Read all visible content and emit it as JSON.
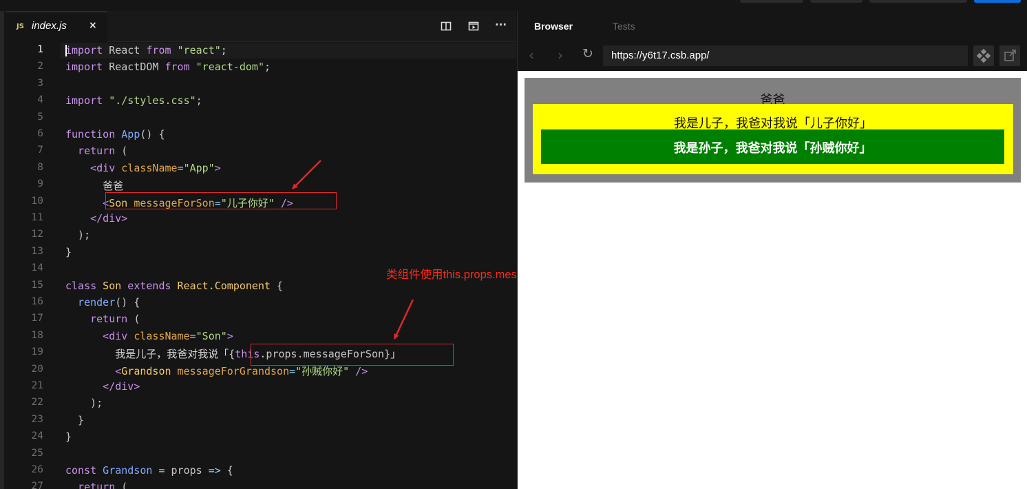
{
  "editor": {
    "tab": {
      "lang_badge": "JS",
      "filename": "index.js",
      "close_glyph": "×"
    },
    "actions": [
      "split-editor-icon",
      "preview-icon",
      "more-icon"
    ],
    "more_glyph": "···",
    "current_line": 1,
    "line_numbers": [
      "1",
      "2",
      "3",
      "4",
      "5",
      "6",
      "7",
      "8",
      "9",
      "10",
      "11",
      "12",
      "13",
      "14",
      "15",
      "16",
      "17",
      "18",
      "19",
      "20",
      "21",
      "22",
      "23",
      "24",
      "25",
      "26",
      "27"
    ],
    "lines": [
      [
        [
          "kw",
          "import"
        ],
        [
          "id",
          " React "
        ],
        [
          "kw",
          "from"
        ],
        [
          "str",
          " \"react\""
        ],
        [
          "id",
          ";"
        ]
      ],
      [
        [
          "kw",
          "import"
        ],
        [
          "id",
          " ReactDOM "
        ],
        [
          "kw",
          "from"
        ],
        [
          "str",
          " \"react-dom\""
        ],
        [
          "id",
          ";"
        ]
      ],
      [],
      [
        [
          "kw",
          "import"
        ],
        [
          "str",
          " \"./styles.css\""
        ],
        [
          "id",
          ";"
        ]
      ],
      [],
      [
        [
          "kw",
          "function"
        ],
        [
          "fn",
          " App"
        ],
        [
          "id",
          "() {"
        ]
      ],
      [
        [
          "kw",
          "  return"
        ],
        [
          "id",
          " ("
        ]
      ],
      [
        [
          "tag",
          "    <div"
        ],
        [
          "attr",
          " className"
        ],
        [
          "op",
          "="
        ],
        [
          "str",
          "\"App\""
        ],
        [
          "tag",
          ">"
        ]
      ],
      [
        [
          "txt",
          "      爸爸"
        ]
      ],
      [
        [
          "tag",
          "      <"
        ],
        [
          "cls",
          "Son"
        ],
        [
          "attr",
          " messageForSon"
        ],
        [
          "op",
          "="
        ],
        [
          "str",
          "\"儿子你好\""
        ],
        [
          "tag",
          " />"
        ]
      ],
      [
        [
          "tag",
          "    </div>"
        ]
      ],
      [
        [
          "id",
          "  );"
        ]
      ],
      [
        [
          "id",
          "}"
        ]
      ],
      [],
      [
        [
          "kw",
          "class"
        ],
        [
          "cls",
          " Son"
        ],
        [
          "kw",
          " extends"
        ],
        [
          "cls",
          " React.Component"
        ],
        [
          "id",
          " {"
        ]
      ],
      [
        [
          "fn",
          "  render"
        ],
        [
          "id",
          "() {"
        ]
      ],
      [
        [
          "kw",
          "    return"
        ],
        [
          "id",
          " ("
        ]
      ],
      [
        [
          "tag",
          "      <div"
        ],
        [
          "attr",
          " className"
        ],
        [
          "op",
          "="
        ],
        [
          "str",
          "\"Son\""
        ],
        [
          "tag",
          ">"
        ]
      ],
      [
        [
          "txt",
          "        我是儿子，我爸对我说「"
        ],
        [
          "id",
          "{"
        ],
        [
          "kw",
          "this"
        ],
        [
          "id",
          ".props.messageForSon}"
        ],
        [
          "txt",
          "」"
        ]
      ],
      [
        [
          "tag",
          "        <"
        ],
        [
          "cls",
          "Grandson"
        ],
        [
          "attr",
          " messageForGrandson"
        ],
        [
          "op",
          "="
        ],
        [
          "str",
          "\"孙贼你好\""
        ],
        [
          "tag",
          " />"
        ]
      ],
      [
        [
          "tag",
          "      </div>"
        ]
      ],
      [
        [
          "id",
          "    );"
        ]
      ],
      [
        [
          "id",
          "  }"
        ]
      ],
      [
        [
          "id",
          "}"
        ]
      ],
      [],
      [
        [
          "kw",
          "const"
        ],
        [
          "fn",
          " Grandson"
        ],
        [
          "op",
          " ="
        ],
        [
          "id",
          " props "
        ],
        [
          "op",
          "=>"
        ],
        [
          "id",
          " {"
        ]
      ],
      [
        [
          "kw",
          "  return"
        ],
        [
          "id",
          " ("
        ]
      ]
    ]
  },
  "annotation": {
    "text": "类组件使用this.props.message",
    "color": "#ff2a1a"
  },
  "browser": {
    "tabs": [
      "Browser",
      "Tests"
    ],
    "url": "https://y6t17.csb.app/",
    "nav": {
      "back_glyph": "‹",
      "forward_glyph": "›",
      "refresh_glyph": "↻"
    },
    "render": {
      "app_text": "爸爸",
      "son_text": "我是儿子，我爸对我说「儿子你好」",
      "grandson_text": "我是孙子，我爸对我说「孙贼你好」",
      "colors": {
        "app_bg": "#808080",
        "son_bg": "#ffff00",
        "grandson_bg": "#008000"
      }
    }
  }
}
